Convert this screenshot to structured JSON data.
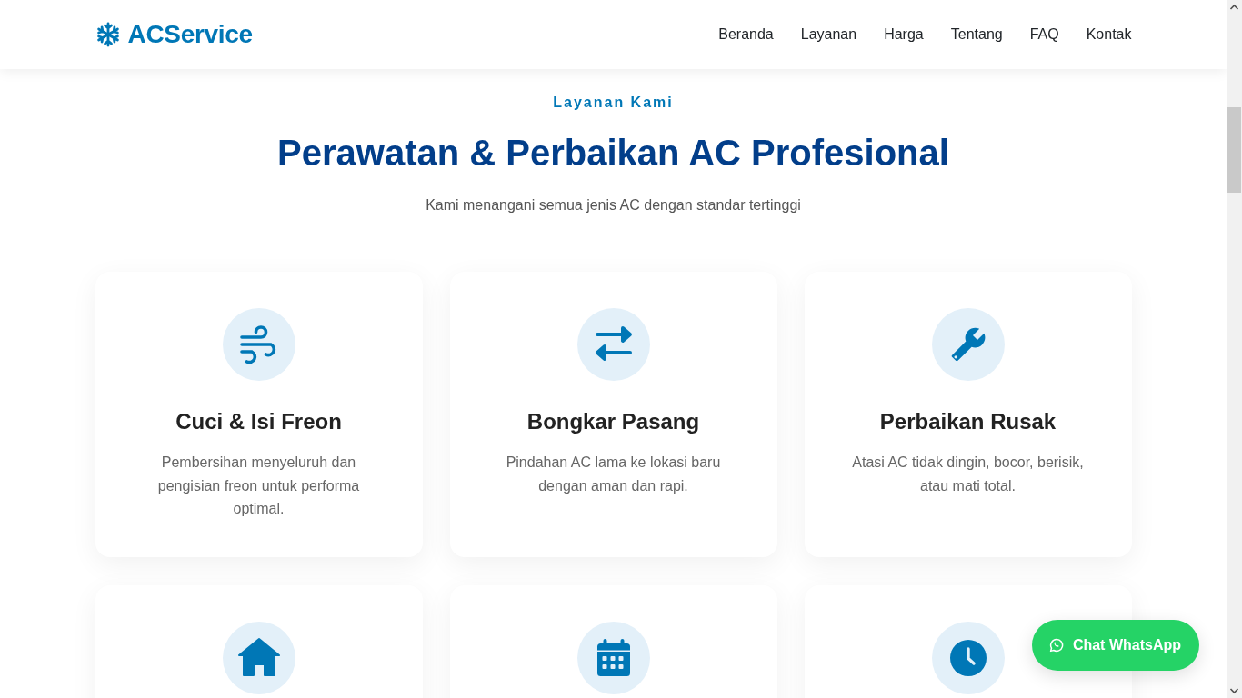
{
  "header": {
    "logo": "ACService",
    "nav": [
      "Beranda",
      "Layanan",
      "Harga",
      "Tentang",
      "FAQ",
      "Kontak"
    ]
  },
  "section": {
    "eyebrow": "Layanan Kami",
    "title": "Perawatan & Perbaikan AC Profesional",
    "subtitle": "Kami menangani semua jenis AC dengan standar tertinggi"
  },
  "services": [
    {
      "kind": "wind",
      "title": "Cuci & Isi Freon",
      "description": "Pembersihan menyeluruh dan pengisian freon untuk performa optimal."
    },
    {
      "kind": "arrows",
      "title": "Bongkar Pasang",
      "description": "Pindahan AC lama ke lokasi baru dengan aman dan rapi."
    },
    {
      "kind": "wrench",
      "title": "Perbaikan Rusak",
      "description": "Atasi AC tidak dingin, bocor, berisik, atau mati total."
    },
    {
      "kind": "house"
    },
    {
      "kind": "calendar"
    },
    {
      "kind": "clock"
    }
  ],
  "chat_button": {
    "label": "Chat WhatsApp"
  }
}
